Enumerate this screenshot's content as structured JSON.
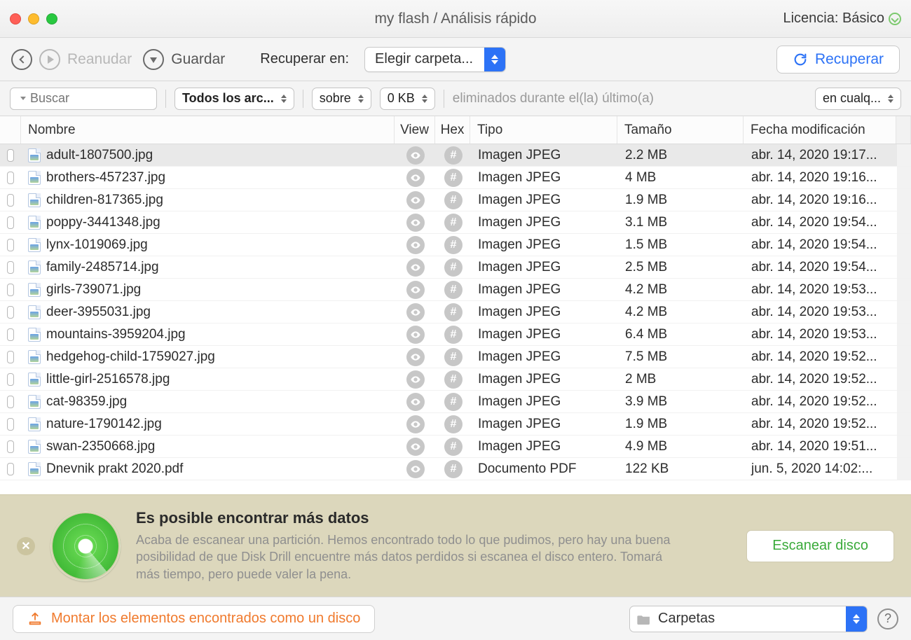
{
  "titlebar": {
    "title": "my flash / Análisis rápido",
    "license_label": "Licencia: Básico"
  },
  "toolbar": {
    "back_icon": "chevron-left",
    "resume_label": "Reanudar",
    "save_label": "Guardar",
    "recover_in_label": "Recuperar en:",
    "folder_select_label": "Elegir carpeta...",
    "recover_button": "Recuperar"
  },
  "filters": {
    "search_placeholder": "Buscar",
    "type_filter": "Todos los arc...",
    "size_mode": "sobre",
    "size_value": "0 KB",
    "time_label": "eliminados durante el(la) último(a)",
    "time_value": "en cualq..."
  },
  "columns": {
    "name": "Nombre",
    "view": "View",
    "hex": "Hex",
    "type": "Tipo",
    "size": "Tamaño",
    "date": "Fecha modificación"
  },
  "rows": [
    {
      "name": "adult-1807500.jpg",
      "type": "Imagen JPEG",
      "size": "2.2 MB",
      "date": "abr. 14, 2020 19:17...",
      "selected": true
    },
    {
      "name": "brothers-457237.jpg",
      "type": "Imagen JPEG",
      "size": "4 MB",
      "date": "abr. 14, 2020 19:16..."
    },
    {
      "name": "children-817365.jpg",
      "type": "Imagen JPEG",
      "size": "1.9 MB",
      "date": "abr. 14, 2020 19:16..."
    },
    {
      "name": "poppy-3441348.jpg",
      "type": "Imagen JPEG",
      "size": "3.1 MB",
      "date": "abr. 14, 2020 19:54..."
    },
    {
      "name": "lynx-1019069.jpg",
      "type": "Imagen JPEG",
      "size": "1.5 MB",
      "date": "abr. 14, 2020 19:54..."
    },
    {
      "name": "family-2485714.jpg",
      "type": "Imagen JPEG",
      "size": "2.5 MB",
      "date": "abr. 14, 2020 19:54..."
    },
    {
      "name": "girls-739071.jpg",
      "type": "Imagen JPEG",
      "size": "4.2 MB",
      "date": "abr. 14, 2020 19:53..."
    },
    {
      "name": "deer-3955031.jpg",
      "type": "Imagen JPEG",
      "size": "4.2 MB",
      "date": "abr. 14, 2020 19:53..."
    },
    {
      "name": "mountains-3959204.jpg",
      "type": "Imagen JPEG",
      "size": "6.4 MB",
      "date": "abr. 14, 2020 19:53..."
    },
    {
      "name": "hedgehog-child-1759027.jpg",
      "type": "Imagen JPEG",
      "size": "7.5 MB",
      "date": "abr. 14, 2020 19:52..."
    },
    {
      "name": "little-girl-2516578.jpg",
      "type": "Imagen JPEG",
      "size": "2 MB",
      "date": "abr. 14, 2020 19:52..."
    },
    {
      "name": "cat-98359.jpg",
      "type": "Imagen JPEG",
      "size": "3.9 MB",
      "date": "abr. 14, 2020 19:52..."
    },
    {
      "name": "nature-1790142.jpg",
      "type": "Imagen JPEG",
      "size": "1.9 MB",
      "date": "abr. 14, 2020 19:52..."
    },
    {
      "name": "swan-2350668.jpg",
      "type": "Imagen JPEG",
      "size": "4.9 MB",
      "date": "abr. 14, 2020 19:51..."
    },
    {
      "name": "Dnevnik prakt 2020.pdf",
      "type": "Documento PDF",
      "size": "122 KB",
      "date": "jun. 5, 2020 14:02:..."
    }
  ],
  "banner": {
    "title": "Es posible encontrar más datos",
    "body": "Acaba de escanear una partición. Hemos encontrado todo lo que pudimos, pero hay una buena posibilidad de que Disk Drill encuentre más datos perdidos si escanea el disco entero. Tomará más tiempo, pero puede valer la pena.",
    "button": "Escanear disco"
  },
  "bottom": {
    "mount_label": "Montar los elementos encontrados como un disco",
    "folders_label": "Carpetas"
  }
}
